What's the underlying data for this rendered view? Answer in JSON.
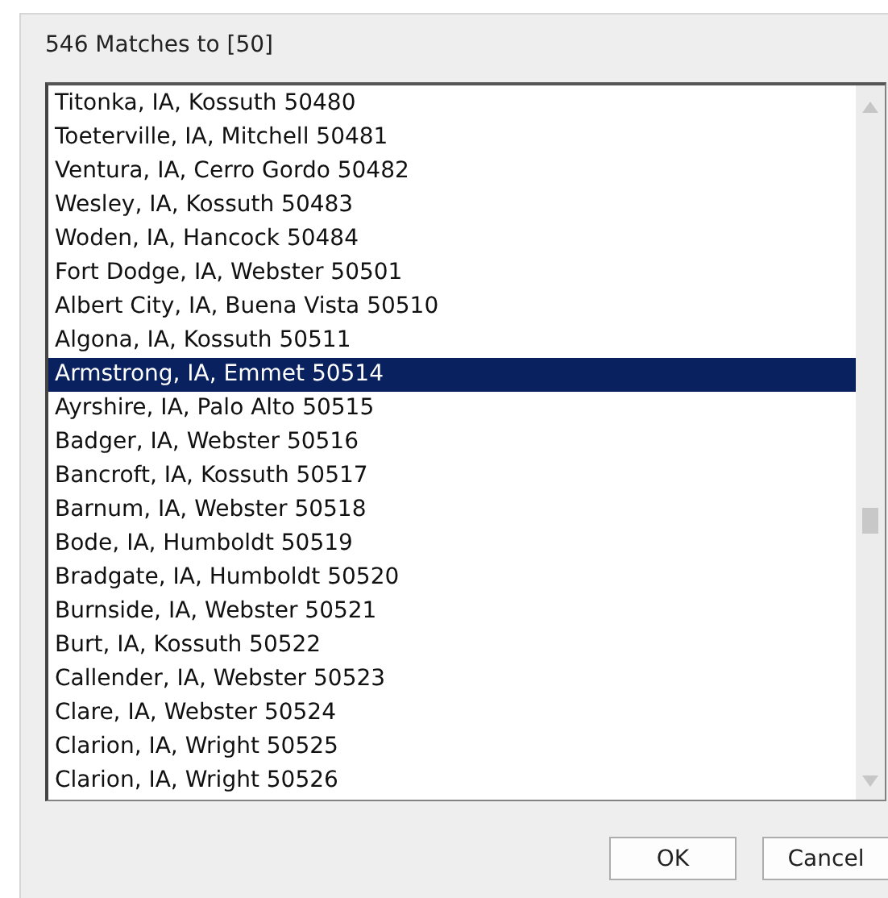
{
  "header": "546 Matches to [50]",
  "list": {
    "items": [
      {
        "text": "Titonka, IA, Kossuth 50480",
        "selected": false
      },
      {
        "text": "Toeterville, IA, Mitchell 50481",
        "selected": false
      },
      {
        "text": "Ventura, IA, Cerro Gordo 50482",
        "selected": false
      },
      {
        "text": "Wesley, IA, Kossuth 50483",
        "selected": false
      },
      {
        "text": "Woden, IA, Hancock 50484",
        "selected": false
      },
      {
        "text": "Fort Dodge, IA, Webster 50501",
        "selected": false
      },
      {
        "text": "Albert City, IA, Buena Vista 50510",
        "selected": false
      },
      {
        "text": "Algona, IA, Kossuth 50511",
        "selected": false
      },
      {
        "text": "Armstrong, IA, Emmet 50514",
        "selected": true
      },
      {
        "text": "Ayrshire, IA, Palo Alto 50515",
        "selected": false
      },
      {
        "text": "Badger, IA, Webster 50516",
        "selected": false
      },
      {
        "text": "Bancroft, IA, Kossuth 50517",
        "selected": false
      },
      {
        "text": "Barnum, IA, Webster 50518",
        "selected": false
      },
      {
        "text": "Bode, IA, Humboldt 50519",
        "selected": false
      },
      {
        "text": "Bradgate, IA, Humboldt 50520",
        "selected": false
      },
      {
        "text": "Burnside, IA, Webster 50521",
        "selected": false
      },
      {
        "text": "Burt, IA, Kossuth 50522",
        "selected": false
      },
      {
        "text": "Callender, IA, Webster 50523",
        "selected": false
      },
      {
        "text": "Clare, IA, Webster 50524",
        "selected": false
      },
      {
        "text": "Clarion, IA, Wright 50525",
        "selected": false
      },
      {
        "text": "Clarion, IA, Wright 50526",
        "selected": false
      }
    ]
  },
  "buttons": [
    "OK",
    "Cancel"
  ]
}
